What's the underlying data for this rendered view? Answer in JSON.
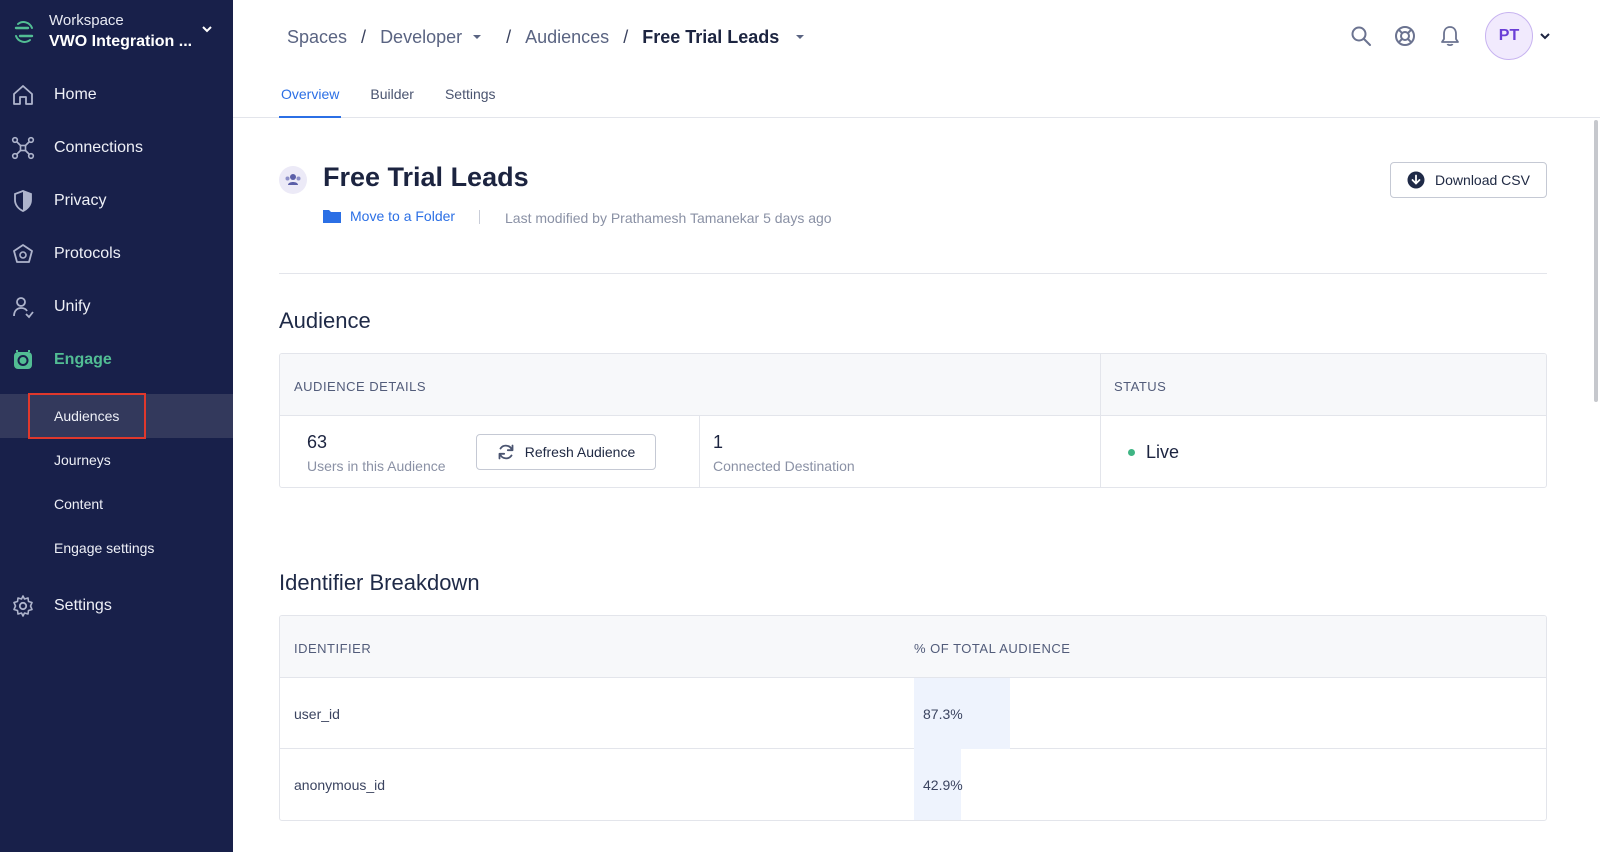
{
  "workspace": {
    "label": "Workspace",
    "name": "VWO Integration ..."
  },
  "sidebar": {
    "items": [
      {
        "label": "Home",
        "icon": "home-icon"
      },
      {
        "label": "Connections",
        "icon": "connections-icon"
      },
      {
        "label": "Privacy",
        "icon": "shield-icon"
      },
      {
        "label": "Protocols",
        "icon": "protocols-icon"
      },
      {
        "label": "Unify",
        "icon": "unify-icon"
      },
      {
        "label": "Engage",
        "icon": "engage-icon"
      },
      {
        "label": "Settings",
        "icon": "gear-icon"
      }
    ],
    "engage_sub": [
      {
        "label": "Audiences"
      },
      {
        "label": "Journeys"
      },
      {
        "label": "Content"
      },
      {
        "label": "Engage settings"
      }
    ]
  },
  "breadcrumb": {
    "spaces": "Spaces",
    "developer": "Developer",
    "audiences": "Audiences",
    "current": "Free Trial Leads"
  },
  "user": {
    "initials": "PT"
  },
  "tabs": [
    {
      "label": "Overview"
    },
    {
      "label": "Builder"
    },
    {
      "label": "Settings"
    }
  ],
  "page": {
    "title": "Free Trial Leads",
    "folder_link": "Move to a Folder",
    "last_modified": "Last modified by Prathamesh Tamanekar 5 days ago",
    "download_label": "Download CSV"
  },
  "audience": {
    "section_title": "Audience",
    "details_header": "AUDIENCE DETAILS",
    "status_header": "STATUS",
    "users_count": "63",
    "users_label": "Users in this Audience",
    "refresh_label": "Refresh Audience",
    "destinations_count": "1",
    "destinations_label": "Connected Destination",
    "status": "Live"
  },
  "identifiers": {
    "section_title": "Identifier Breakdown",
    "col_identifier": "IDENTIFIER",
    "col_percent": "% OF TOTAL AUDIENCE",
    "rows": [
      {
        "name": "user_id",
        "percent": "87.3%",
        "share": 0.873
      },
      {
        "name": "anonymous_id",
        "percent": "42.9%",
        "share": 0.429
      }
    ]
  },
  "colors": {
    "sidebar_bg": "#18204a",
    "accent_blue": "#2b6fe5",
    "engage_green": "#52bd94",
    "live_green": "#3fb584",
    "highlight_red": "#e0382c"
  }
}
